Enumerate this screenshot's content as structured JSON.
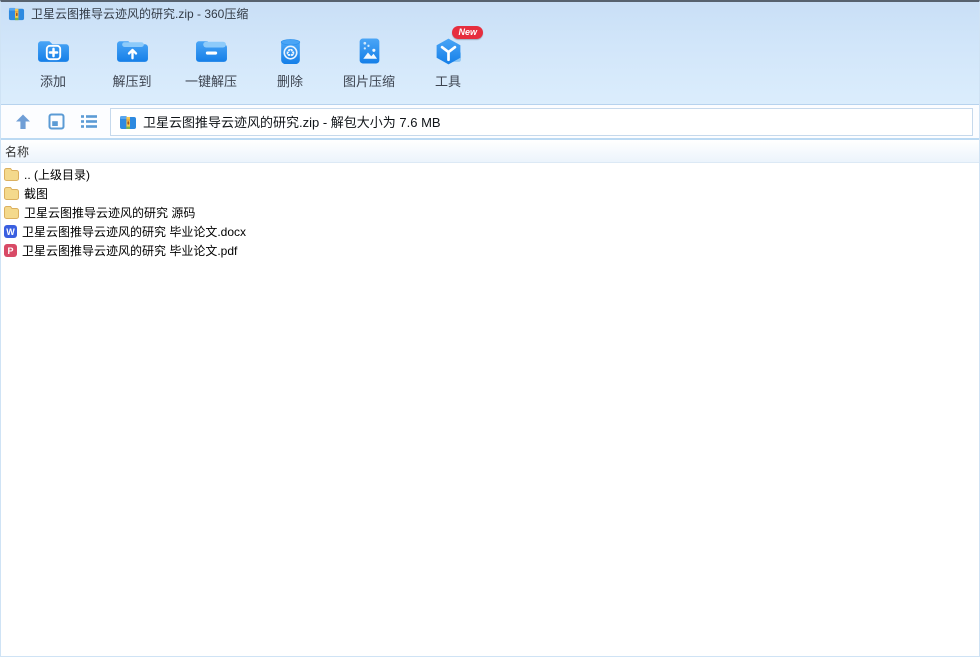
{
  "window": {
    "title": "卫星云图推导云迹风的研究.zip - 360压缩"
  },
  "toolbar": {
    "items": [
      {
        "label": "添加",
        "icon": "add-folder-icon"
      },
      {
        "label": "解压到",
        "icon": "extract-to-icon"
      },
      {
        "label": "一键解压",
        "icon": "one-click-extract-icon"
      },
      {
        "label": "删除",
        "icon": "delete-icon"
      },
      {
        "label": "图片压缩",
        "icon": "image-compress-icon"
      },
      {
        "label": "工具",
        "icon": "tools-icon",
        "badge": "New"
      }
    ]
  },
  "navbar": {
    "address": "卫星云图推导云迹风的研究.zip - 解包大小为 7.6 MB"
  },
  "file_list": {
    "header": "名称",
    "rows": [
      {
        "name": ".. (上级目录)",
        "type": "folder"
      },
      {
        "name": "截图",
        "type": "folder"
      },
      {
        "name": "卫星云图推导云迹风的研究 源码",
        "type": "folder"
      },
      {
        "name": "卫星云图推导云迹风的研究 毕业论文.docx",
        "type": "docx"
      },
      {
        "name": "卫星云图推导云迹风的研究 毕业论文.pdf",
        "type": "pdf"
      }
    ]
  },
  "icons": {
    "word_letter": "W",
    "pdf_letter": "P"
  },
  "colors": {
    "accent_blue": "#1f8ceb",
    "light_blue_chrome": "#d2e6fa",
    "folder_yellow": "#f4d98c",
    "word_blue": "#3a5fe0",
    "pdf_red": "#d84a66",
    "badge_red": "#e62e3e"
  }
}
